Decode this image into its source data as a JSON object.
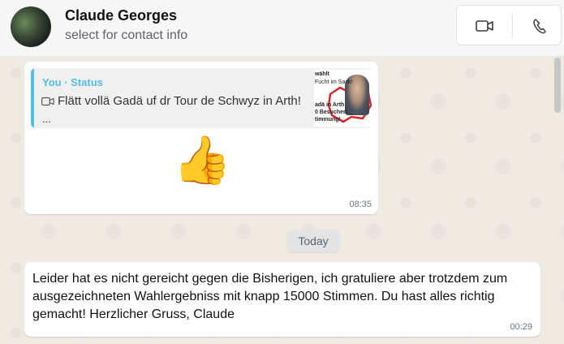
{
  "header": {
    "contact_name": "Claude Georges",
    "subtitle": "select for contact info",
    "video_icon": "video-camera-icon",
    "phone_icon": "phone-icon"
  },
  "messages": [
    {
      "quote": {
        "title": "You · Status",
        "media_icon": "video-icon",
        "text": "Flätt vollä Gadä uf dr Tour de Schwyz in Arth!",
        "more": "...",
        "thumbnail_lines": [
          "wählt",
          "Fucht im Sack!",
          "adä in Arth",
          "0 Besucher!",
          "timmung!"
        ]
      },
      "emoji": "👍",
      "time": "08:35"
    },
    {
      "text": "Leider hat es nicht gereicht gegen die Bisherigen, ich gratuliere aber trotzdem zum ausgezeichneten Wahlergebniss mit knapp 15000 Stimmen. Du hast alles richtig gemacht! Herzlicher Gruss, Claude",
      "time": "00:29"
    }
  ],
  "date_separator": "Today",
  "colors": {
    "quote_accent": "#53bdeb",
    "chat_background": "#efeae2",
    "bubble": "#ffffff"
  }
}
